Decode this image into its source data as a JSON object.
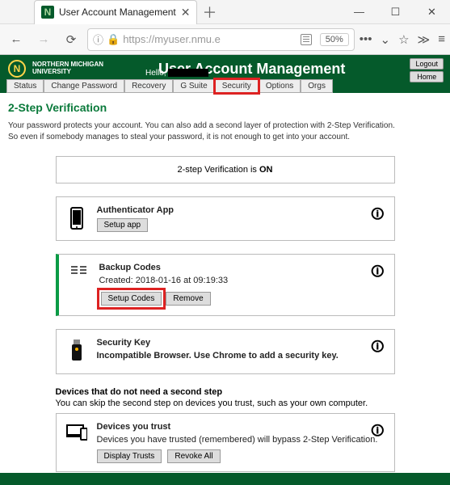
{
  "browser": {
    "tab_title": "User Account Management",
    "url": "https://myuser.nmu.e",
    "zoom": "50%"
  },
  "header": {
    "app_title": "User Account Management",
    "hello": "Hello,",
    "uni_line1": "NORTHERN MICHIGAN",
    "uni_line2": "UNIVERSITY",
    "logout": "Logout",
    "home": "Home"
  },
  "tabs": {
    "status": "Status",
    "change_pw": "Change Password",
    "recovery": "Recovery",
    "gsuite": "G Suite",
    "security": "Security",
    "options": "Options",
    "orgs": "Orgs"
  },
  "page": {
    "title": "2-Step Verification",
    "intro1": "Your password protects your account. You can also add a second layer of protection with 2-Step Verification.",
    "intro2": "So even if somebody manages to steal your password, it is not enough to get into your account.",
    "status_pre": "2-step Verification is ",
    "status_val": "ON",
    "auth": {
      "title": "Authenticator App",
      "setup": "Setup app"
    },
    "codes": {
      "title": "Backup Codes",
      "created": "Created: 2018-01-16 at 09:19:33",
      "setup": "Setup Codes",
      "remove": "Remove"
    },
    "key": {
      "title": "Security Key",
      "msg": "Incompatible Browser. Use Chrome to add a security key."
    },
    "devices_hdr": {
      "h": "Devices that do not need a second step",
      "s": "You can skip the second step on devices you trust, such as your own computer."
    },
    "trust": {
      "title": "Devices you trust",
      "msg": "Devices you have trusted (remembered) will bypass 2-Step Verification.",
      "display": "Display Trusts",
      "revoke": "Revoke All"
    }
  }
}
